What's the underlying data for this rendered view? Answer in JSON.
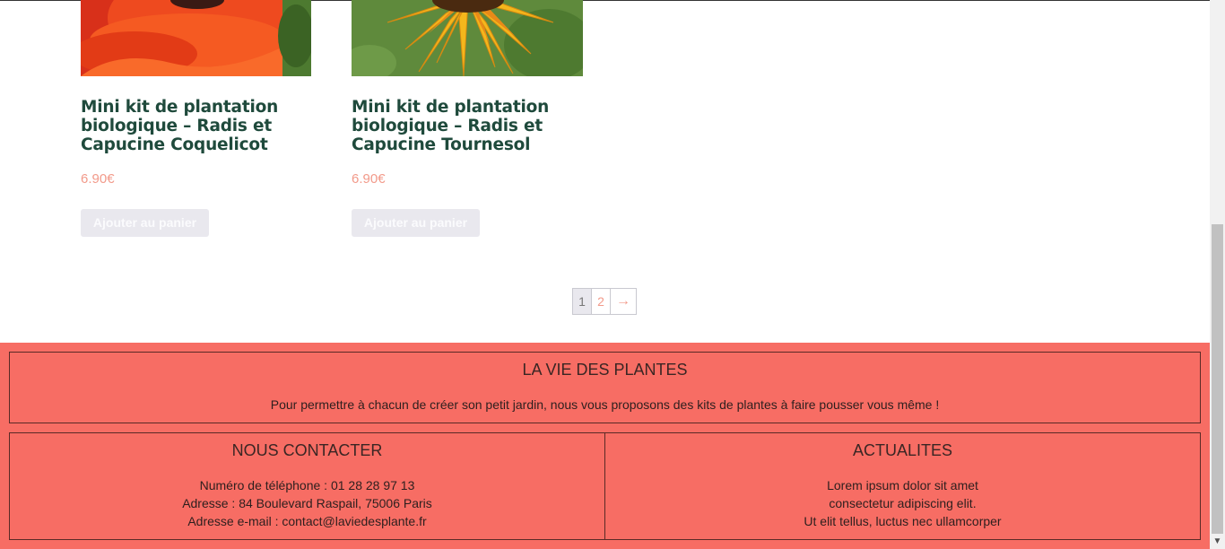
{
  "products": [
    {
      "title": "Mini kit de plantation biologique – Radis et Capucine Coquelicot",
      "price": "6.90€",
      "button_label": "Ajouter au panier",
      "image": "poppy-flower"
    },
    {
      "title": "Mini kit de plantation biologique – Radis et Capucine Tournesol",
      "price": "6.90€",
      "button_label": "Ajouter au panier",
      "image": "sunflower"
    }
  ],
  "pagination": {
    "current": "1",
    "next_page": "2",
    "next_arrow": "→"
  },
  "footer": {
    "about": {
      "title": "LA VIE DES PLANTES",
      "text": "Pour permettre à chacun de créer son petit jardin, nous vous proposons des kits de plantes à faire pousser vous même !"
    },
    "contact": {
      "title": "NOUS CONTACTER",
      "phone": "Numéro de téléphone : 01 28 28 97 13",
      "address": "Adresse : 84 Boulevard Raspail, 75006 Paris",
      "email": "Adresse e-mail : contact@laviedesplante.fr"
    },
    "news": {
      "title": "ACTUALITES",
      "line1": "Lorem ipsum dolor sit amet",
      "line2": "consectetur adipiscing elit.",
      "line3": "Ut elit tellus, luctus nec ullamcorper"
    }
  },
  "colors": {
    "footer_bg": "#f76d64",
    "title": "#1f4a3c",
    "price": "#f29a8a",
    "button_bg": "#e9e8ee"
  }
}
